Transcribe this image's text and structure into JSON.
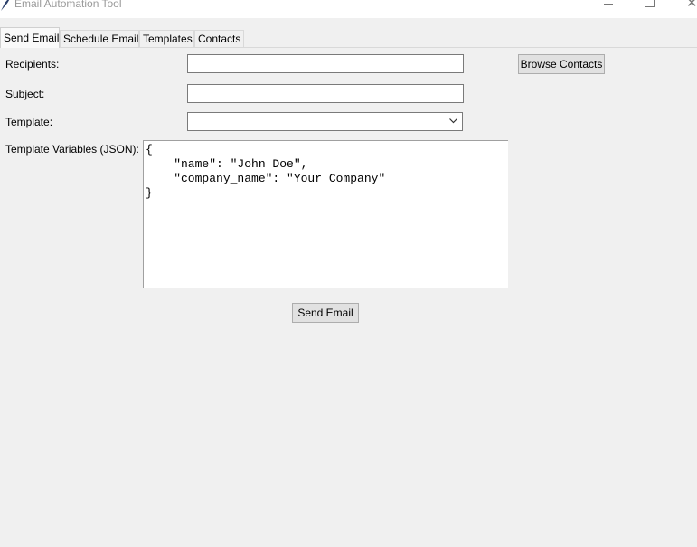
{
  "window": {
    "title": "Email Automation Tool",
    "icons": {
      "app": "feather-icon",
      "minimize": "minimize-icon",
      "maximize": "maximize-icon",
      "close": "close-icon"
    },
    "close_glyph": "✕"
  },
  "tabs": [
    {
      "label": "Send Email",
      "active": true
    },
    {
      "label": "Schedule Email",
      "active": false
    },
    {
      "label": "Templates",
      "active": false
    },
    {
      "label": "Contacts",
      "active": false
    }
  ],
  "form": {
    "recipients_label": "Recipients:",
    "recipients_value": "",
    "subject_label": "Subject:",
    "subject_value": "",
    "template_label": "Template:",
    "template_value": "",
    "variables_label": "Template Variables (JSON):",
    "variables_value": "{\n    \"name\": \"John Doe\",\n    \"company_name\": \"Your Company\"\n}",
    "browse_button": "Browse Contacts",
    "send_button": "Send Email"
  }
}
